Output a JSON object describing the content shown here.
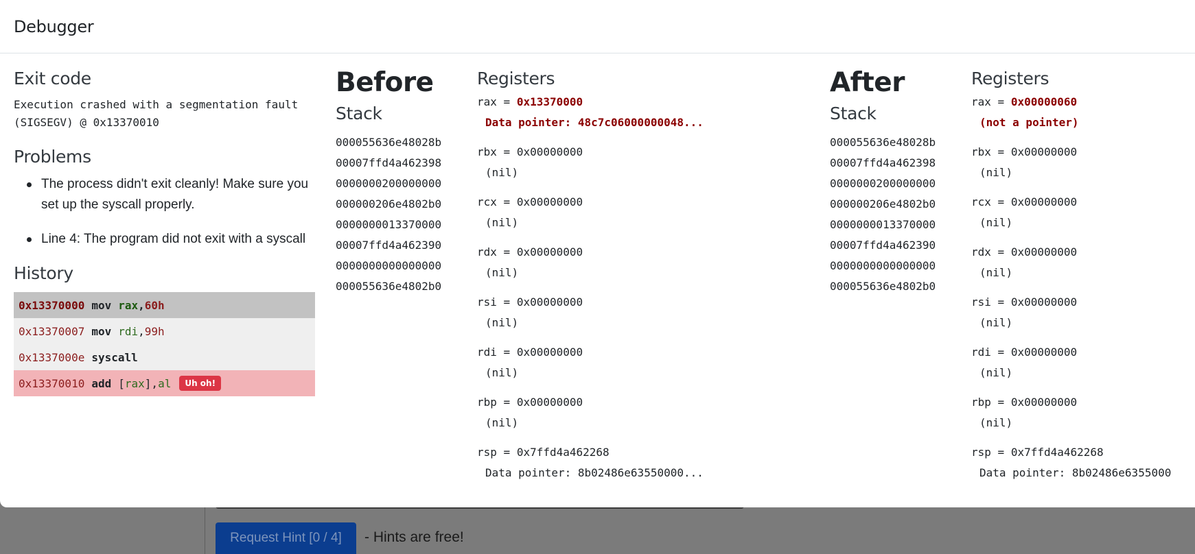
{
  "background": {
    "hint_button": "Request Hint [0 / 4]",
    "hint_text": "- Hints are free!"
  },
  "modal": {
    "title": "Debugger"
  },
  "exit": {
    "heading": "Exit code",
    "line1": "Execution crashed with a segmentation fault",
    "line2": "(SIGSEGV) @ 0x13370010"
  },
  "problems": {
    "heading": "Problems",
    "items": [
      "The process didn't exit cleanly! Make sure you set up the syscall properly.",
      "Line 4: The program did not exit with a syscall"
    ]
  },
  "history": {
    "heading": "History",
    "rows": [
      {
        "addr": "0x13370000",
        "op": "mov",
        "reg": "rax",
        "comma": ",",
        "num": "60h"
      },
      {
        "addr": "0x13370007",
        "op": "mov",
        "reg": "rdi",
        "comma": ",",
        "num": "99h"
      },
      {
        "addr": "0x1337000e",
        "op": "syscall"
      },
      {
        "addr": "0x13370010",
        "op": "add",
        "bracket_open": "[",
        "reg": "rax",
        "bracket_close": "]",
        "comma": ",",
        "reg2": "al",
        "badge": "Uh oh!"
      }
    ]
  },
  "before": {
    "heading": "Before",
    "stack_heading": "Stack",
    "stack": [
      "000055636e48028b",
      "00007ffd4a462398",
      "0000000200000000",
      "000000206e4802b0",
      "0000000013370000",
      "00007ffd4a462390",
      "0000000000000000",
      "000055636e4802b0"
    ],
    "registers_heading": "Registers",
    "registers": [
      {
        "name": "rax",
        "eq": " = ",
        "value": "0x13370000",
        "note": "Data pointer: 48c7c06000000048..."
      },
      {
        "name": "rbx",
        "eq": " = ",
        "value": "0x00000000",
        "note": "(nil)"
      },
      {
        "name": "rcx",
        "eq": " = ",
        "value": "0x00000000",
        "note": "(nil)"
      },
      {
        "name": "rdx",
        "eq": " = ",
        "value": "0x00000000",
        "note": "(nil)"
      },
      {
        "name": "rsi",
        "eq": " = ",
        "value": "0x00000000",
        "note": "(nil)"
      },
      {
        "name": "rdi",
        "eq": " = ",
        "value": "0x00000000",
        "note": "(nil)"
      },
      {
        "name": "rbp",
        "eq": " = ",
        "value": "0x00000000",
        "note": "(nil)"
      },
      {
        "name": "rsp",
        "eq": " = ",
        "value": "0x7ffd4a462268",
        "note": "Data pointer: 8b02486e63550000..."
      }
    ]
  },
  "after": {
    "heading": "After",
    "stack_heading": "Stack",
    "stack": [
      "000055636e48028b",
      "00007ffd4a462398",
      "0000000200000000",
      "000000206e4802b0",
      "0000000013370000",
      "00007ffd4a462390",
      "0000000000000000",
      "000055636e4802b0"
    ],
    "registers_heading": "Registers",
    "registers": [
      {
        "name": "rax",
        "eq": " = ",
        "value": "0x00000060",
        "note": "(not a pointer)"
      },
      {
        "name": "rbx",
        "eq": " = ",
        "value": "0x00000000",
        "note": "(nil)"
      },
      {
        "name": "rcx",
        "eq": " = ",
        "value": "0x00000000",
        "note": "(nil)"
      },
      {
        "name": "rdx",
        "eq": " = ",
        "value": "0x00000000",
        "note": "(nil)"
      },
      {
        "name": "rsi",
        "eq": " = ",
        "value": "0x00000000",
        "note": "(nil)"
      },
      {
        "name": "rdi",
        "eq": " = ",
        "value": "0x00000000",
        "note": "(nil)"
      },
      {
        "name": "rbp",
        "eq": " = ",
        "value": "0x00000000",
        "note": "(nil)"
      },
      {
        "name": "rsp",
        "eq": " = ",
        "value": "0x7ffd4a462268",
        "note": "Data pointer: 8b02486e6355000"
      }
    ]
  }
}
